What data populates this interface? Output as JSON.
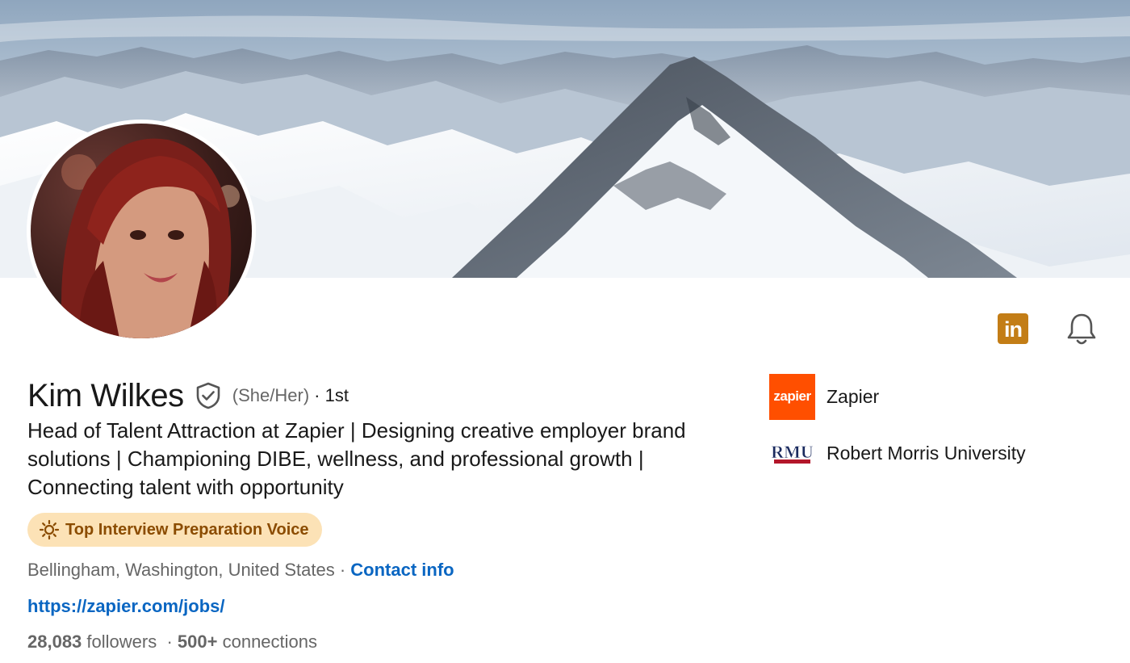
{
  "profile": {
    "name": "Kim Wilkes",
    "pronouns": "(She/Her)",
    "degree": "· 1st",
    "headline": "Head of Talent Attraction at Zapier | Designing creative employer brand solutions | Championing DIBE, wellness, and professional growth | Connecting talent with opportunity",
    "badge": {
      "label": "Top Interview Preparation Voice",
      "icon": "lightbulb-icon"
    },
    "location": "Bellingham, Washington, United States",
    "location_separator": " · ",
    "contact_label": "Contact info",
    "website": "https://zapier.com/jobs/",
    "followers_count": "28,083",
    "followers_label": "followers",
    "stats_separator": "  · ",
    "connections_count": "500+",
    "connections_label": "connections"
  },
  "actions": {
    "linkedin_logo": "in",
    "icons": [
      "linkedin-logo-icon",
      "bell-icon"
    ]
  },
  "affiliations": [
    {
      "name": "Zapier",
      "logo_text": "zapier",
      "logo_color": "#ff4f00"
    },
    {
      "name": "Robert Morris University",
      "logo_text": "RMU",
      "logo_color": "#1a2a5e"
    }
  ],
  "colors": {
    "link": "#0a66c2",
    "badge_bg": "#fce2b6",
    "badge_text": "#8b4c00",
    "linkedin_logo_bg": "#c37d16"
  }
}
